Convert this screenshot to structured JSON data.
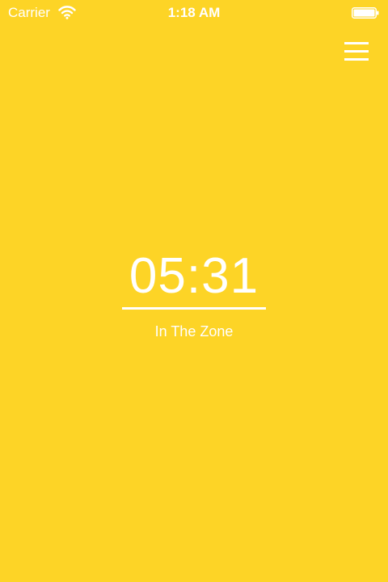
{
  "status_bar": {
    "carrier": "Carrier",
    "time": "1:18 AM",
    "wifi_icon": "wifi-icon",
    "battery_icon": "battery-icon"
  },
  "toolbar": {
    "menu_icon": "hamburger-menu-icon"
  },
  "timer": {
    "value": "05:31",
    "label": "In The Zone"
  },
  "theme": {
    "background": "#FDD426",
    "foreground": "#FFFFFF"
  }
}
